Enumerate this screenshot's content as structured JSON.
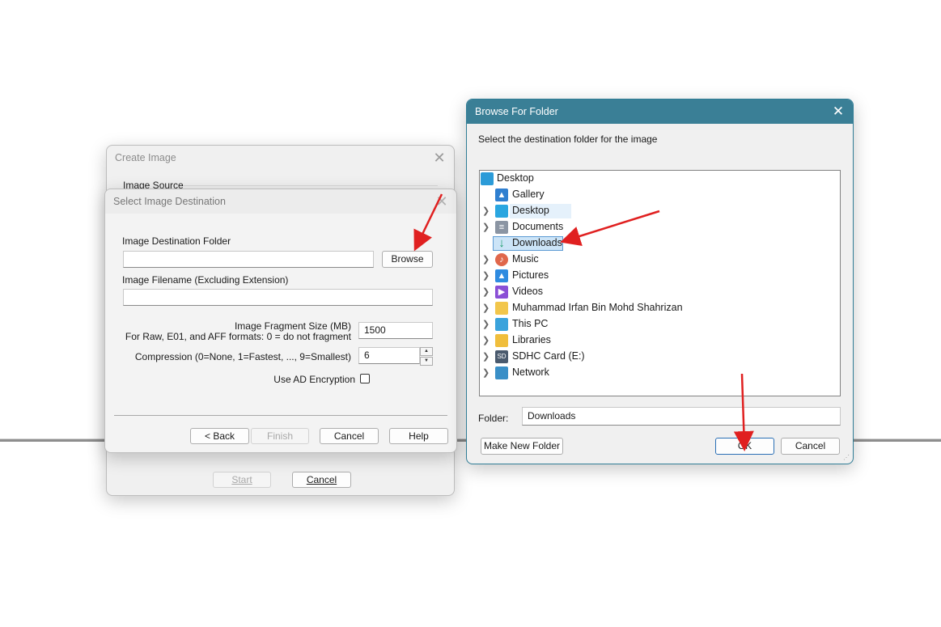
{
  "create_image": {
    "title": "Create Image",
    "image_source_label": "Image Source",
    "start_label": "Start",
    "cancel_label": "Cancel"
  },
  "select_destination": {
    "title": "Select Image Destination",
    "folder_label": "Image Destination Folder",
    "folder_value": "",
    "browse_label": "Browse",
    "filename_label": "Image Filename (Excluding Extension)",
    "filename_value": "",
    "fragment_label": "Image Fragment Size (MB)",
    "fragment_note": "For Raw, E01, and AFF formats: 0 = do not fragment",
    "fragment_value": "1500",
    "compression_label": "Compression (0=None, 1=Fastest, ..., 9=Smallest)",
    "compression_value": "6",
    "encryption_label": "Use AD Encryption",
    "back_label": "< Back",
    "finish_label": "Finish",
    "cancel_label": "Cancel",
    "help_label": "Help"
  },
  "browse_folder": {
    "title": "Browse For Folder",
    "instruction": "Select the destination folder for the image",
    "tree": {
      "root": "Desktop",
      "items": [
        "Gallery",
        "Desktop",
        "Documents",
        "Downloads",
        "Music",
        "Pictures",
        "Videos",
        "Muhammad Irfan Bin Mohd Shahrizan",
        "This PC",
        "Libraries",
        "SDHC Card (E:)",
        "Network"
      ],
      "selected": "Downloads"
    },
    "folder_label": "Folder:",
    "folder_value": "Downloads",
    "new_folder_label": "Make New Folder",
    "ok_label": "OK",
    "cancel_label": "Cancel"
  },
  "colors": {
    "accent": "#3a7f96",
    "annotation_arrow": "#e02020",
    "selection": "#cce4f7"
  },
  "icons": [
    "close-icon",
    "desktop-icon",
    "gallery-icon",
    "downloads-icon",
    "documents-icon",
    "music-icon",
    "pictures-icon",
    "videos-icon",
    "folder-icon",
    "this-pc-icon",
    "libraries-icon",
    "sd-card-icon",
    "network-icon",
    "chevron-right-icon",
    "spin-up-icon",
    "spin-down-icon"
  ]
}
